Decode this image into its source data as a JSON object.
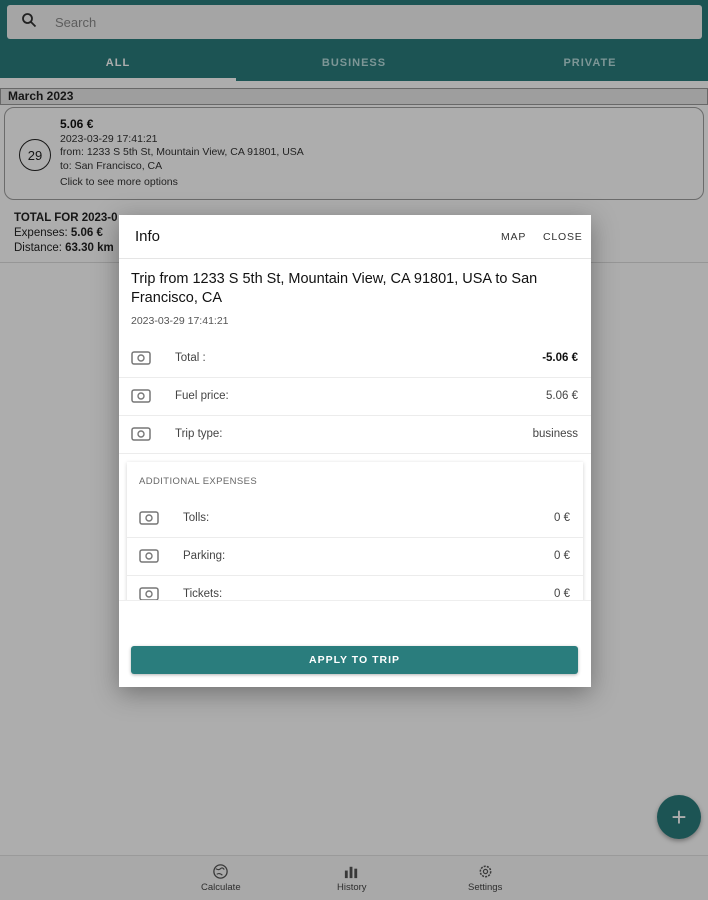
{
  "colors": {
    "primary": "#2a7d7d",
    "surface": "#ffffff"
  },
  "search": {
    "placeholder": "Search",
    "icon": "search-icon"
  },
  "tabs": [
    {
      "label": "ALL",
      "active": true
    },
    {
      "label": "BUSINESS",
      "active": false
    },
    {
      "label": "PRIVATE",
      "active": false
    }
  ],
  "history": {
    "month_header": "March 2023",
    "trip": {
      "day": "29",
      "amount": "5.06 €",
      "datetime": "2023-03-29 17:41:21",
      "from": "from: 1233 S 5th St, Mountain View, CA 91801, USA",
      "to": "to: San Francisco, CA",
      "hint": "Click to see more options"
    },
    "totals": {
      "title": "TOTAL FOR 2023-0",
      "expenses_label": "Expenses:",
      "expenses_value": "5.06 €",
      "distance_label": "Distance:",
      "distance_value": "63.30 km"
    }
  },
  "dialog": {
    "title": "Info",
    "map_label": "MAP",
    "close_label": "CLOSE",
    "trip_title": "Trip from 1233 S 5th St, Mountain View, CA 91801, USA to San Francisco, CA",
    "trip_date": "2023-03-29 17:41:21",
    "rows": [
      {
        "label": "Total :",
        "value": "-5.06 €",
        "icon": "money-icon"
      },
      {
        "label": "Fuel price:",
        "value": "5.06 €",
        "icon": "money-icon"
      },
      {
        "label": "Trip type:",
        "value": "business",
        "icon": "money-icon"
      }
    ],
    "additional": {
      "header": "ADDITIONAL EXPENSES",
      "rows": [
        {
          "label": "Tolls:",
          "value": "0 €",
          "icon": "money-icon"
        },
        {
          "label": "Parking:",
          "value": "0 €",
          "icon": "money-icon"
        },
        {
          "label": "Tickets:",
          "value": "0 €",
          "icon": "money-icon"
        }
      ]
    },
    "apply_label": "APPLY TO TRIP"
  },
  "fab": {
    "label": "+",
    "icon": "plus-icon"
  },
  "bottom_nav": [
    {
      "label": "Calculate",
      "icon": "globe-icon"
    },
    {
      "label": "History",
      "icon": "bar-chart-icon"
    },
    {
      "label": "Settings",
      "icon": "gear-icon"
    }
  ]
}
